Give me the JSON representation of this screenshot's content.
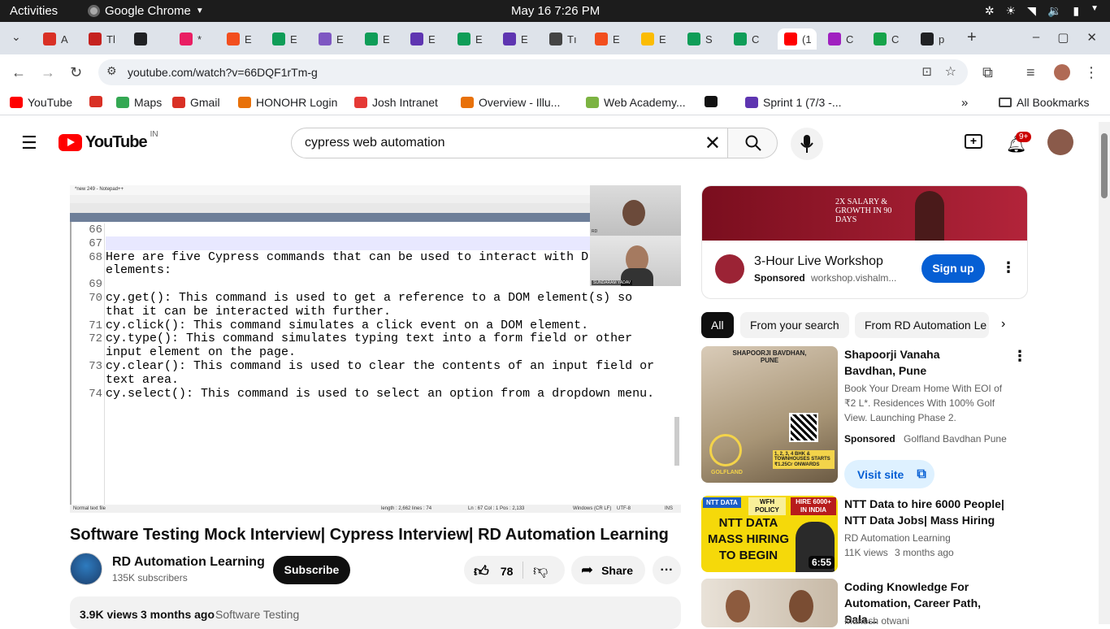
{
  "system": {
    "activities": "Activities",
    "app_name": "Google Chrome",
    "clock": "May 16  7:26 PM"
  },
  "tabs": [
    {
      "label": "A",
      "color": "#d93025"
    },
    {
      "label": "Tl",
      "color": "#c5221f"
    },
    {
      "label": "",
      "color": "#202124"
    },
    {
      "label": "*",
      "color": "#e91e63"
    },
    {
      "label": "E",
      "color": "#f24e1e"
    },
    {
      "label": "E",
      "color": "#0f9d58"
    },
    {
      "label": "E",
      "color": "#7e57c2"
    },
    {
      "label": "E",
      "color": "#0f9d58"
    },
    {
      "label": "E",
      "color": "#5e35b1"
    },
    {
      "label": "E",
      "color": "#0f9d58"
    },
    {
      "label": "E",
      "color": "#5e35b1"
    },
    {
      "label": "Tı",
      "color": "#444"
    },
    {
      "label": "E",
      "color": "#f24e1e"
    },
    {
      "label": "E",
      "color": "#fbbc04"
    },
    {
      "label": "S",
      "color": "#0f9d58"
    },
    {
      "label": "C",
      "color": "#0f9d58"
    },
    {
      "label": "(1",
      "color": "#ff0000"
    },
    {
      "label": "C",
      "color": "#a020c0"
    },
    {
      "label": "C",
      "color": "#16a34a"
    },
    {
      "label": "p",
      "color": "#202124"
    }
  ],
  "address_bar": {
    "url": "youtube.com/watch?v=66DQF1rTm-g"
  },
  "bookmarks": [
    {
      "label": "YouTube",
      "color": "#ff0000"
    },
    {
      "label": "",
      "color": "#d93025"
    },
    {
      "label": "Maps",
      "color": "#34a853"
    },
    {
      "label": "Gmail",
      "color": "#d93025"
    },
    {
      "label": "HONOHR Login",
      "color": "#e8710a"
    },
    {
      "label": "Josh Intranet",
      "color": "#e53935"
    },
    {
      "label": "Overview - Illu...",
      "color": "#e8710a"
    },
    {
      "label": "Web Academy...",
      "color": "#7cb342"
    },
    {
      "label": "",
      "color": "#111"
    },
    {
      "label": "Sprint 1 (7/3 -...",
      "color": "#5e35b1"
    }
  ],
  "bookmarks_all": "All Bookmarks",
  "youtube": {
    "logo_text": "YouTube",
    "region": "IN",
    "search_query": "cypress web automation",
    "notif_count": "9+"
  },
  "notepad": {
    "title": "*new 249 - Notepad++",
    "line_numbers": [
      "66",
      "67",
      "68",
      "",
      "69",
      "70",
      "",
      "71",
      "72",
      "",
      "73",
      "",
      "74"
    ],
    "lines": [
      "",
      "",
      "Here are five Cypress commands that can be used to interact with D",
      "elements:",
      "",
      "cy.get(): This command is used to get a reference to a DOM element(s) so",
      "that it can be interacted with further.",
      "cy.click(): This command simulates a click event on a DOM element.",
      "cy.type(): This command simulates typing text into a form field or other",
      "input element on the page.",
      "cy.clear(): This command is used to clear the contents of an input field or",
      "text area.",
      "cy.select(): This command is used to select an option from a dropdown menu."
    ],
    "status_left": "Normal text file",
    "status_len": "length : 2,662    lines : 74",
    "status_pos": "Ln : 67    Col : 1    Pos : 2,133",
    "status_eol": "Windows (CR LF)",
    "status_enc": "UTF-8",
    "status_ins": "INS",
    "webcam_name": "SUNDARAM YADAV",
    "webcam_top_label": "RD"
  },
  "video": {
    "title": "Software Testing Mock Interview| Cypress Interview| RD Automation Learning",
    "channel": "RD Automation Learning",
    "subscribers": "135K subscribers",
    "subscribe": "Subscribe",
    "likes": "78",
    "share": "Share",
    "views": "3.9K views",
    "age": "3 months ago",
    "category": "Software Testing"
  },
  "ad": {
    "title": "3-Hour Live Workshop",
    "sponsored": "Sponsored",
    "domain": "workshop.vishalm...",
    "cta": "Sign up",
    "banner_text": "2X SALARY & GROWTH IN 90 DAYS"
  },
  "chips": [
    "All",
    "From your search",
    "From RD Automation Le"
  ],
  "recommendations": [
    {
      "title": "Shapoorji Vanaha Bavdhan, Pune",
      "desc": "Book Your Dream Home With EOI of ₹2 L*. Residences With 100% Golf View. Launching Phase 2.",
      "sponsored": "Sponsored",
      "advertiser": "Golfland Bavdhan Pune",
      "cta": "Visit site",
      "thumb_top": "SHAPOORJI BAVDHAN, PUNE",
      "thumb_price": "1, 2, 3, 4 BHK & TOWNHOUSES STARTS ₹1.25Cr ONWARDS",
      "thumb_brand": "GOLFLAND"
    },
    {
      "title": "NTT Data to hire 6000 People| NTT Data Jobs| Mass Hiring",
      "channel": "RD Automation Learning",
      "views": "11K views",
      "age": "3 months ago",
      "duration": "6:55",
      "thumb_main": "NTT DATA MASS HIRING TO BEGIN",
      "thumb_badge1": "WFH POLICY",
      "thumb_badge2": "HIRE 6000+ IN INDIA",
      "thumb_logo": "NTT DATA"
    },
    {
      "title": "Coding Knowledge For Automation, Career Path, Sala...",
      "channel": "Mukesh otwani"
    }
  ]
}
